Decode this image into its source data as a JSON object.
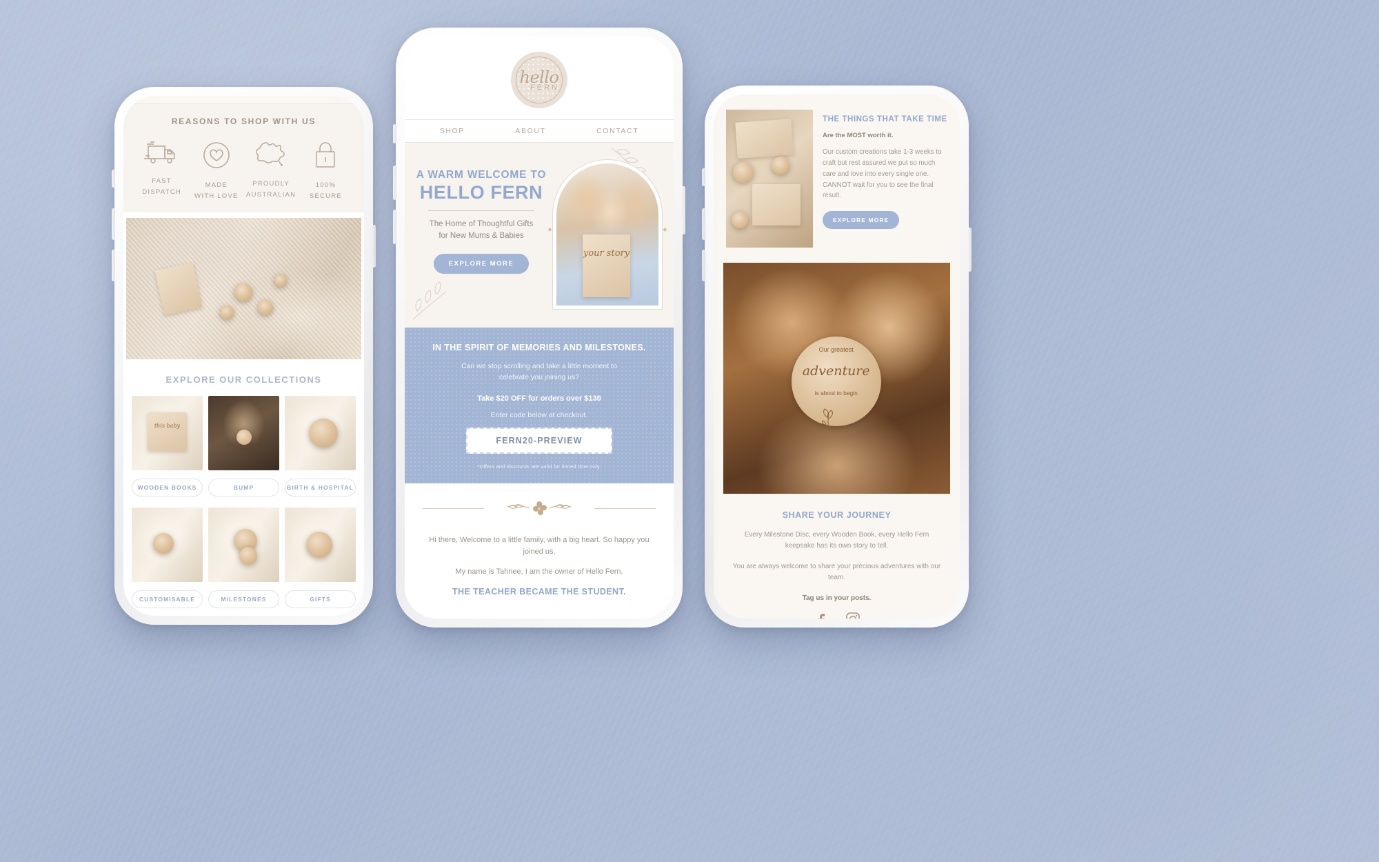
{
  "background": {
    "color": "#b3c0da"
  },
  "theme": {
    "blue": "#92a7cc",
    "button_blue": "#a3b5d4",
    "cream": "#f7f3ee",
    "tan": "#a99a8c"
  },
  "left_phone": {
    "reasons_title": "REASONS TO SHOP WITH US",
    "reasons": [
      {
        "icon": "delivery-truck-icon",
        "line1": "FAST",
        "line2": "DISPATCH"
      },
      {
        "icon": "heart-circle-icon",
        "line1": "MADE",
        "line2": "WITH LOVE"
      },
      {
        "icon": "australia-map-icon",
        "line1": "PROUDLY",
        "line2": "AUSTRALIAN"
      },
      {
        "icon": "padlock-icon",
        "line1": "100%",
        "line2": "SECURE"
      }
    ],
    "hero_image_alt": "gift box with wooden keepsakes on knitted blanket",
    "collections_title": "EXPLORE OUR COLLECTIONS",
    "collection_tiles_row1": [
      {
        "alt": "wooden book on baby blanket"
      },
      {
        "alt": "pregnant woman holding milestone disc"
      },
      {
        "alt": "newborn wrapped with birth announcement disc"
      }
    ],
    "chips_row1": [
      "WOODEN BOOKS",
      "BUMP",
      "BIRTH & HOSPITAL"
    ],
    "collection_tiles_row2": [
      {
        "alt": "baby feet with wooden disc"
      },
      {
        "alt": "stack of wooden milestone discs"
      },
      {
        "alt": "hands holding engraved wooden disc"
      }
    ],
    "chips_row2": [
      "CUSTOMISABLE",
      "MILESTONES",
      "GIFTS"
    ]
  },
  "center_phone": {
    "logo": {
      "script": "hello",
      "word": "FERN"
    },
    "nav": [
      "SHOP",
      "ABOUT",
      "CONTACT"
    ],
    "hero": {
      "kicker": "A WARM WELCOME TO",
      "title": "HELLO FERN",
      "subtitle_line1": "The Home of Thoughtful Gifts",
      "subtitle_line2": "for New Mums & Babies",
      "cta": "EXPLORE MORE",
      "image_alt": "family kissing baby holding a 'your story' wooden plaque",
      "plaque_text": "your story"
    },
    "promo": {
      "heading": "IN THE SPIRIT OF MEMORIES AND MILESTONES.",
      "body_line1": "Can we stop scrolling and take a little moment to",
      "body_line2": "celebrate you joining us?",
      "offer": "Take $20 OFF for orders over $130",
      "instruction": "Enter code below at checkout.",
      "code": "FERN20-PREVIEW",
      "disclaimer": "*Offers and discounts are valid for limted time only."
    },
    "footer": {
      "line1": "Hi there, Welcome to a little family, with a big heart. So happy you joined us.",
      "line2": "My name is Tahnee, I am the owner of Hello Fern.",
      "line3": "THE TEACHER BECAME THE STUDENT."
    }
  },
  "right_phone": {
    "top": {
      "image_alt": "wooden keepsake discs in a gift box",
      "heading": "THE THINGS THAT TAKE TIME",
      "subheading": "Are the MOST worth it.",
      "paragraph": "Our custom creations take 1-3 weeks to craft but rest assured we put so much care and love into every single one. CANNOT wait for you to see the final result.",
      "cta": "EXPLORE MORE"
    },
    "feature_image": {
      "alt": "couple holding a wooden announcement disc",
      "disc_line1": "Our greatest",
      "disc_script": "adventure",
      "disc_line2": "is about to begin"
    },
    "footer": {
      "heading": "SHARE YOUR JOURNEY",
      "paragraph1": "Every Milestone Disc, every Wooden Book, every Hello Fern keepsake has its own story to tell.",
      "paragraph2": "You are always welcome to share your precious adventures with our team.",
      "tagline": "Tag us in your posts.",
      "social": [
        "facebook-icon",
        "instagram-icon"
      ]
    }
  }
}
